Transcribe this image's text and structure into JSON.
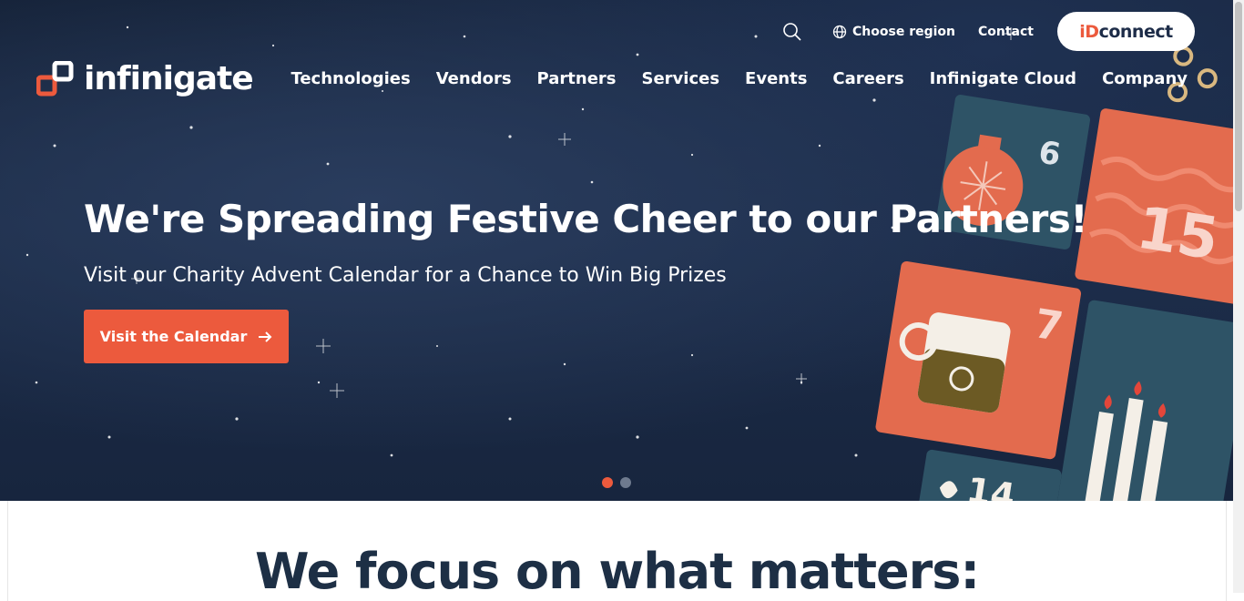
{
  "header": {
    "logo_text": "infinigate",
    "search_icon": "search-icon",
    "region_label": "Choose region",
    "contact_label": "Contact",
    "idconnect": {
      "prefix": "iD",
      "rest": "connect"
    }
  },
  "nav": {
    "items": [
      {
        "label": "Technologies"
      },
      {
        "label": "Vendors"
      },
      {
        "label": "Partners"
      },
      {
        "label": "Services"
      },
      {
        "label": "Events"
      },
      {
        "label": "Careers"
      },
      {
        "label": "Infinigate Cloud"
      },
      {
        "label": "Company"
      }
    ]
  },
  "hero": {
    "title": "We're Spreading Festive Cheer to our Partners!",
    "subtitle": "Visit our Charity Advent Calendar for a Chance to Win Big Prizes",
    "cta_label": "Visit the Calendar",
    "calendar_numbers": [
      "6",
      "15",
      "7",
      "14"
    ],
    "slides_total": 2,
    "active_slide": 1
  },
  "focus": {
    "title": "We focus on what matters:"
  },
  "colors": {
    "accent": "#ec5a3d",
    "navy": "#1d2c48",
    "hero_bg": "#17253e"
  }
}
